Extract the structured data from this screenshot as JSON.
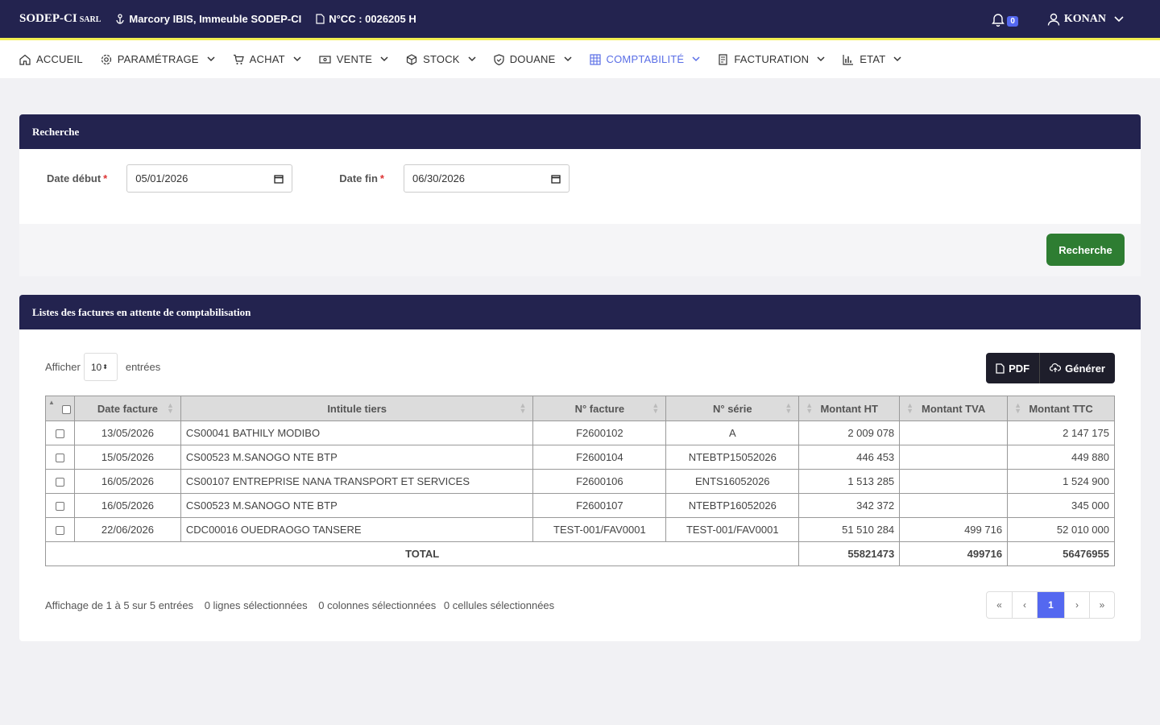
{
  "topbar": {
    "brand": "SODEP-CI",
    "brand_suffix": "SARL",
    "location": "Marcory IBIS, Immeuble SODEP-CI",
    "ncc": "N°CC : 0026205 H",
    "notif_count": "0",
    "user": "KONAN"
  },
  "nav": [
    {
      "label": "ACCUEIL",
      "icon": "home-icon"
    },
    {
      "label": "PARAMÉTRAGE",
      "icon": "gear-icon"
    },
    {
      "label": "ACHAT",
      "icon": "cart-icon"
    },
    {
      "label": "VENTE",
      "icon": "cash-icon"
    },
    {
      "label": "STOCK",
      "icon": "box-icon"
    },
    {
      "label": "DOUANE",
      "icon": "shield-icon"
    },
    {
      "label": "COMPTABILITÉ",
      "icon": "grid-icon"
    },
    {
      "label": "FACTURATION",
      "icon": "invoice-icon"
    },
    {
      "label": "ETAT",
      "icon": "bar-chart-icon"
    }
  ],
  "search": {
    "title": "Recherche",
    "start_label": "Date début",
    "start_value": "05/01/2026",
    "end_label": "Date fin",
    "end_value": "06/30/2026",
    "button": "Recherche"
  },
  "list": {
    "title": "Listes des factures en attente de comptabilisation",
    "show_label": "Afficher",
    "page_length": "10",
    "entries_label": "entrées",
    "pdf_label": "PDF",
    "generate_label": "Générer",
    "columns": [
      "Date facture",
      "Intitule tiers",
      "N° facture",
      "N° série",
      "Montant HT",
      "Montant TVA",
      "Montant TTC"
    ],
    "rows": [
      [
        "13/05/2026",
        "CS00041 BATHILY MODIBO",
        "F2600102",
        "A",
        "2 009 078",
        "",
        "2 147 175"
      ],
      [
        "15/05/2026",
        "CS00523 M.SANOGO NTE BTP",
        "F2600104",
        "NTEBTP15052026",
        "446 453",
        "",
        "449 880"
      ],
      [
        "16/05/2026",
        "CS00107 ENTREPRISE NANA TRANSPORT ET SERVICES",
        "F2600106",
        "ENTS16052026",
        "1 513 285",
        "",
        "1 524 900"
      ],
      [
        "16/05/2026",
        "CS00523 M.SANOGO NTE BTP",
        "F2600107",
        "NTEBTP16052026",
        "342 372",
        "",
        "345 000"
      ],
      [
        "22/06/2026",
        "CDC00016 OUEDRAOGO TANSERE",
        "TEST-001/FAV0001",
        "TEST-001/FAV0001",
        "51 510 284",
        "499 716",
        "52 010 000"
      ]
    ],
    "total_label": "TOTAL",
    "total_ht": "55821473",
    "total_tva": "499716",
    "total_ttc": "56476955",
    "info": "Affichage de 1 à 5 sur 5 entrées",
    "sel_rows": "0 lignes sélectionnées",
    "sel_cols": "0 colonnes sélectionnées",
    "sel_cells": "0 cellules sélectionnées",
    "pager": [
      "«",
      "‹",
      "1",
      "›",
      "»"
    ]
  }
}
